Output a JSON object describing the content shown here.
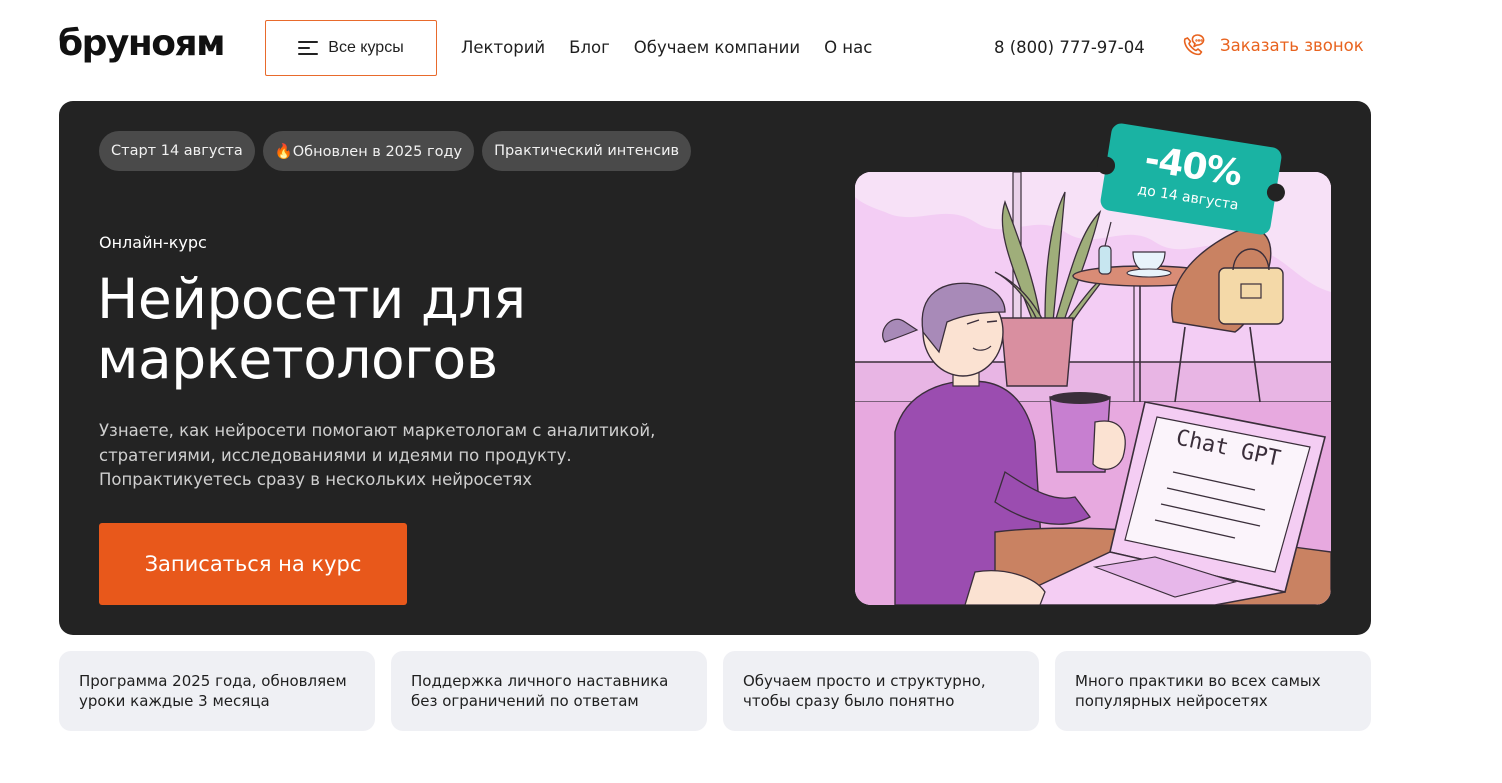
{
  "header": {
    "logo": "бруноям",
    "all_courses_label": "Все курсы",
    "nav": [
      "Лекторий",
      "Блог",
      "Обучаем компании",
      "О нас"
    ],
    "phone": "8 (800) 777-97-04",
    "callback_label": "Заказать звонок"
  },
  "hero": {
    "chips": [
      "Старт 14 августа",
      "🔥Обновлен в 2025 году",
      "Практический интенсив"
    ],
    "eyebrow": "Онлайн-курс",
    "title_line1": "Нейросети для",
    "title_line2": "маркетологов",
    "description": "Узнаете, как нейросети помогают маркетологам с аналитикой, стратегиями, исследованиями и идеями по продукту. Попрактикуетесь сразу в нескольких нейросетях",
    "cta_label": "Записаться на курс",
    "discount_percent": "-40%",
    "discount_until": "до 14 августа",
    "laptop_text": "Chat GPT"
  },
  "features": [
    "Программа 2025 года, обновляем уроки каждые 3 месяца",
    "Поддержка личного наставника без ограничений по ответам",
    "Обучаем просто и структурно, чтобы сразу было понятно",
    "Много практики во всех самых популярных нейросетях"
  ],
  "colors": {
    "accent": "#e8581b",
    "hero_bg": "#232323",
    "chip_bg": "#4a4a4a",
    "ticket": "#1ab3a3",
    "feature_bg": "#eff0f4"
  },
  "icons": {
    "menu": "burger-menu-icon",
    "callback": "phone-chat-icon"
  }
}
